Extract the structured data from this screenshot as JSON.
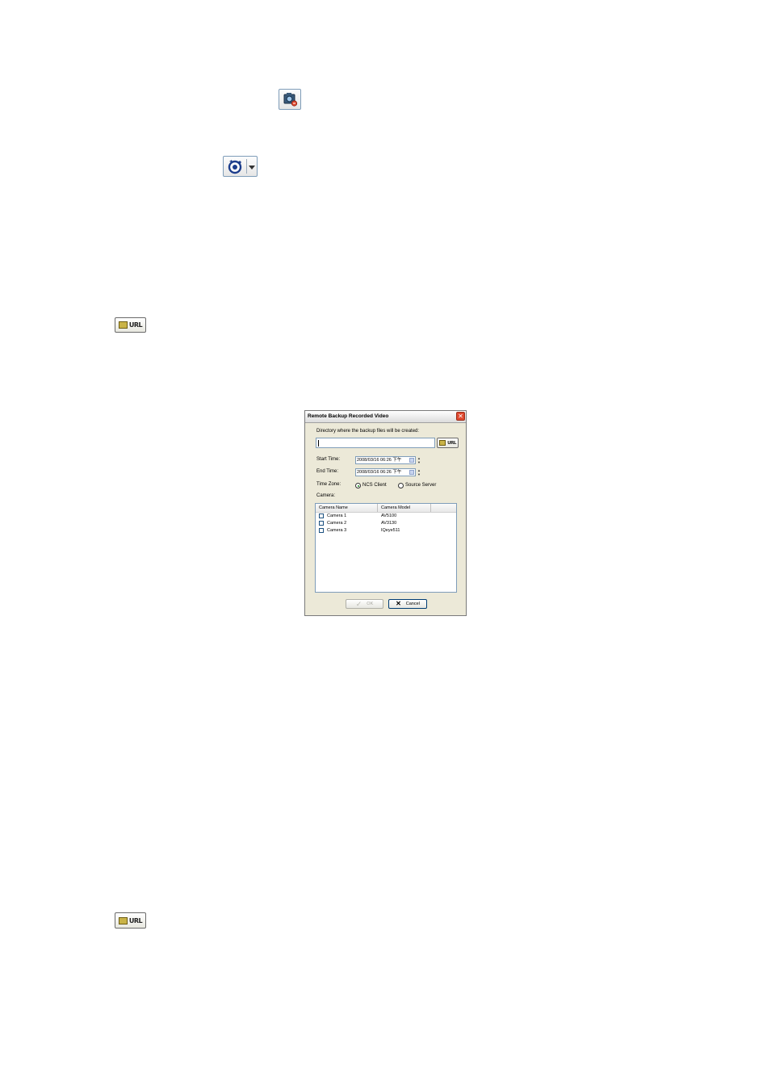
{
  "toolbar_icons": {
    "snapshot_icon": "camera-snapshot-icon",
    "dropdown_icon": "chevron-down-icon"
  },
  "url_button": {
    "label": "URL"
  },
  "dialog": {
    "title": "Remote Backup Recorded Video",
    "close_glyph": "✕",
    "directory_label": "Directory where the backup files will be created:",
    "directory_value": "",
    "url_label": "URL",
    "start_time_label": "Start Time:",
    "start_time_value": "2008/03/16 06:26 下午",
    "end_time_label": "End Time:",
    "end_time_value": "2008/03/16 06:26 下午",
    "time_zone_label": "Time Zone:",
    "time_zone_options": [
      "NCS Client",
      "Source Server"
    ],
    "time_zone_selected": "NCS Client",
    "camera_label": "Camera:",
    "columns": [
      "Camera Name",
      "Camera Model"
    ],
    "cameras": [
      {
        "name": "Camera 1",
        "model": "AV5100",
        "checked": false
      },
      {
        "name": "Camera 2",
        "model": "AV3130",
        "checked": false
      },
      {
        "name": "Camera 3",
        "model": "IQeye511",
        "checked": false
      }
    ],
    "ok_label": "OK",
    "cancel_label": "Cancel"
  },
  "colors": {
    "dialog_bg": "#ece9d8",
    "close_red": "#e0492f",
    "folder_gold": "#c9b347"
  }
}
